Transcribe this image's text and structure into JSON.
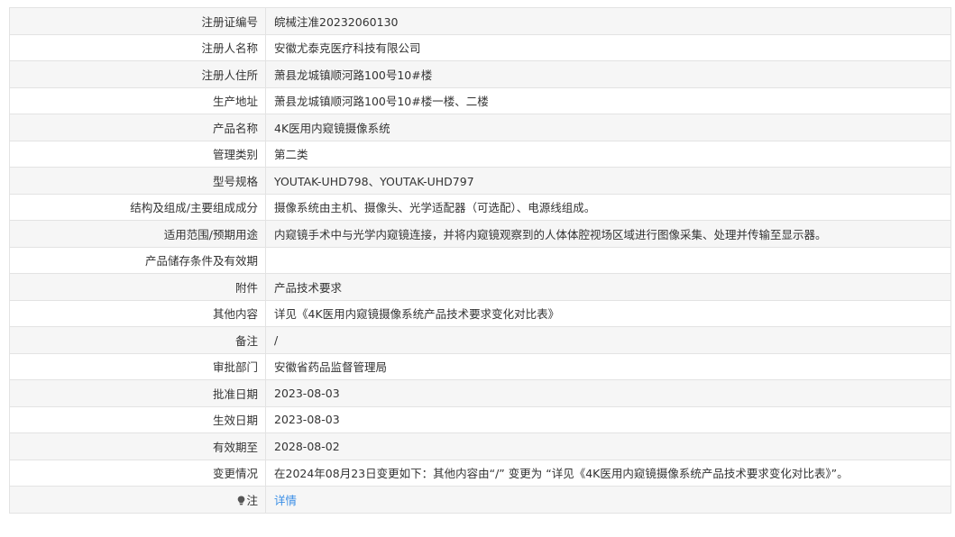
{
  "rows": [
    {
      "label": "注册证编号",
      "value": "皖械注准20232060130"
    },
    {
      "label": "注册人名称",
      "value": "安徽尤泰克医疗科技有限公司"
    },
    {
      "label": "注册人住所",
      "value": "萧县龙城镇顺河路100号10#楼"
    },
    {
      "label": "生产地址",
      "value": "萧县龙城镇顺河路100号10#楼一楼、二楼"
    },
    {
      "label": "产品名称",
      "value": "4K医用内窥镜摄像系统"
    },
    {
      "label": "管理类别",
      "value": "第二类"
    },
    {
      "label": "型号规格",
      "value": "YOUTAK-UHD798、YOUTAK-UHD797"
    },
    {
      "label": "结构及组成/主要组成成分",
      "value": "摄像系统由主机、摄像头、光学适配器（可选配）、电源线组成。"
    },
    {
      "label": "适用范围/预期用途",
      "value": "内窥镜手术中与光学内窥镜连接，并将内窥镜观察到的人体体腔视场区域进行图像采集、处理并传输至显示器。"
    },
    {
      "label": "产品储存条件及有效期",
      "value": ""
    },
    {
      "label": "附件",
      "value": "产品技术要求"
    },
    {
      "label": "其他内容",
      "value": "详见《4K医用内窥镜摄像系统产品技术要求变化对比表》"
    },
    {
      "label": "备注",
      "value": "/"
    },
    {
      "label": "审批部门",
      "value": "安徽省药品监督管理局"
    },
    {
      "label": "批准日期",
      "value": "2023-08-03"
    },
    {
      "label": "生效日期",
      "value": "2023-08-03"
    },
    {
      "label": "有效期至",
      "value": "2028-08-02"
    },
    {
      "label": "变更情况",
      "value": "在2024年08月23日变更如下：其他内容由“/” 变更为 “详见《4K医用内窥镜摄像系统产品技术要求变化对比表》”。"
    },
    {
      "label": "注",
      "value": "详情"
    }
  ],
  "colors": {
    "link": "#3a8ee6",
    "border": "#e3e3e3",
    "row_alt": "#f6f6f6"
  },
  "icons": {
    "note": "lightbulb-icon"
  }
}
